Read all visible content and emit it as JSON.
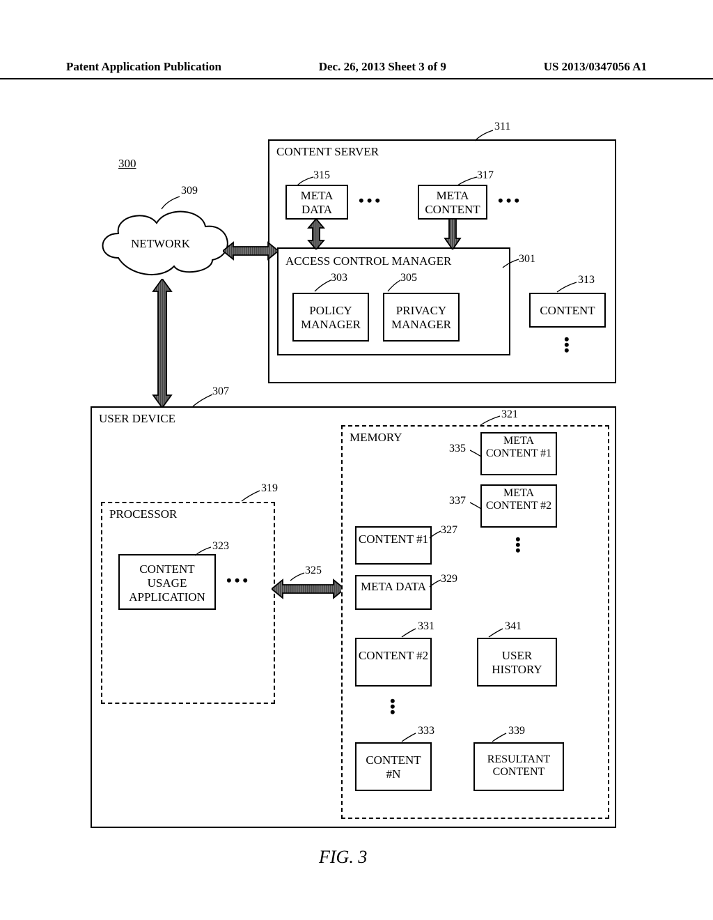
{
  "header": {
    "left": "Patent Application Publication",
    "mid": "Dec. 26, 2013   Sheet 3 of 9",
    "right": "US 2013/0347056 A1"
  },
  "figure_ref_main": "300",
  "refs": {
    "r300": "300",
    "r301": "301",
    "r303": "303",
    "r305": "305",
    "r307": "307",
    "r309": "309",
    "r311": "311",
    "r313": "313",
    "r315": "315",
    "r317": "317",
    "r319": "319",
    "r321": "321",
    "r323": "323",
    "r325": "325",
    "r327": "327",
    "r329": "329",
    "r331": "331",
    "r333": "333",
    "r335": "335",
    "r337": "337",
    "r339": "339",
    "r341": "341"
  },
  "labels": {
    "network": "NETWORK",
    "content_server": "CONTENT\nSERVER",
    "meta_data": "META\nDATA",
    "meta_content": "META\nCONTENT",
    "access_control_manager": "ACCESS CONTROL MANAGER",
    "policy_mgr": "POLICY\nMANAGER",
    "privacy_mgr": "PRIVACY\nMANAGER",
    "content": "CONTENT",
    "user_device": "USER DEVICE",
    "processor": "PROCESSOR",
    "content_usage_app": "CONTENT\nUSAGE\nAPPLICATION",
    "memory": "MEMORY",
    "meta_content_1": "META\nCONTENT\n#1",
    "meta_content_2": "META\nCONTENT\n#2",
    "content_1": "CONTENT\n#1",
    "meta_data2": "META\nDATA",
    "content_2": "CONTENT\n#2",
    "user_history": "USER\nHISTORY",
    "content_n": "CONTENT\n#N",
    "resultant_content": "RESULTANT\nCONTENT"
  },
  "fig_caption": "FIG. 3"
}
